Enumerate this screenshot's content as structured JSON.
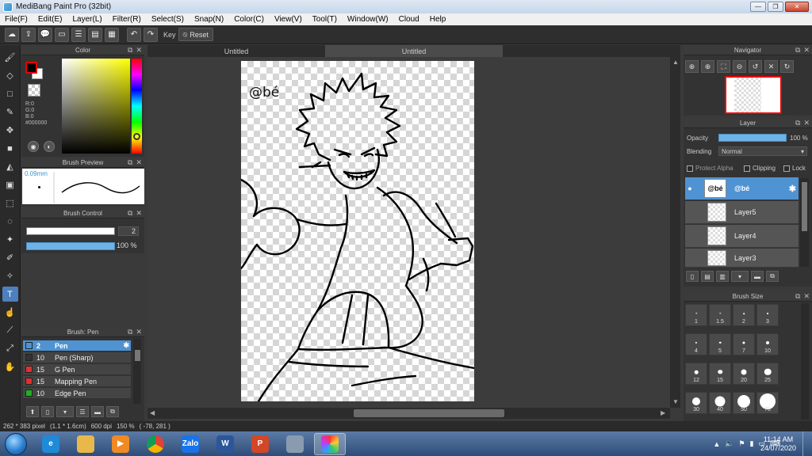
{
  "window": {
    "title": "MediBang Paint Pro (32bit)"
  },
  "menu": [
    "File(F)",
    "Edit(E)",
    "Layer(L)",
    "Filter(R)",
    "Select(S)",
    "Snap(N)",
    "Color(C)",
    "View(V)",
    "Tool(T)",
    "Window(W)",
    "Cloud",
    "Help"
  ],
  "toolbar": {
    "key_label": "Key",
    "reset_label": "Reset"
  },
  "color_panel": {
    "title": "Color",
    "r": "R:0",
    "g": "G:0",
    "b": "B:0",
    "hex": "#000000",
    "foreground": "#000000",
    "background": "#ffffff"
  },
  "brush_preview": {
    "title": "Brush Preview",
    "size": "0.09mm"
  },
  "brush_control": {
    "title": "Brush Control",
    "size_value": "2",
    "opacity_value": "100 %",
    "opacity_fraction": 1.0
  },
  "brush_list": {
    "title": "Brush: Pen",
    "items": [
      {
        "num": "2",
        "name": "Pen",
        "color": "#4f93d2",
        "selected": true
      },
      {
        "num": "10",
        "name": "Pen (Sharp)",
        "color": "#333333",
        "selected": false
      },
      {
        "num": "15",
        "name": "G Pen",
        "color": "#e03030",
        "selected": false
      },
      {
        "num": "15",
        "name": "Mapping Pen",
        "color": "#e03030",
        "selected": false
      },
      {
        "num": "10",
        "name": "Edge Pen",
        "color": "#20b020",
        "selected": false
      }
    ]
  },
  "tabs": [
    "Untitled",
    "Untitled"
  ],
  "canvas": {
    "watermark": "@bé"
  },
  "navigator": {
    "title": "Navigator"
  },
  "layer_panel": {
    "title": "Layer",
    "opacity_label": "Opacity",
    "opacity_value": "100 %",
    "blending_label": "Blending",
    "blending_value": "Normal",
    "protect_alpha": "Protect Alpha",
    "clipping": "Clipping",
    "lock": "Lock",
    "layers": [
      {
        "name": "@bé",
        "thumb_text": "@bé",
        "selected": true
      },
      {
        "name": "Layer5",
        "selected": false
      },
      {
        "name": "Layer4",
        "selected": false
      },
      {
        "name": "Layer3",
        "selected": false
      }
    ]
  },
  "brush_size_panel": {
    "title": "Brush Size",
    "sizes": [
      "1",
      "1.5",
      "2",
      "3",
      "4",
      "5",
      "7",
      "10",
      "12",
      "15",
      "20",
      "25",
      "30",
      "40",
      "50",
      "70"
    ]
  },
  "status": {
    "dimensions": "262 * 383 pixel",
    "physical": "(1.1 * 1.6cm)",
    "dpi": "600 dpi",
    "zoom": "150 %",
    "coords": "( -78, 281 )"
  },
  "taskbar": {
    "apps": [
      {
        "name": "internet-explorer",
        "label": "e",
        "color": "#1f8ad6"
      },
      {
        "name": "file-explorer",
        "label": "",
        "color": "#e8b84a"
      },
      {
        "name": "media-player",
        "label": "▶",
        "color": "#f08a24"
      },
      {
        "name": "chrome",
        "label": "",
        "color": "#dd4b39"
      },
      {
        "name": "zalo",
        "label": "Zalo",
        "color": "#1a73e8"
      },
      {
        "name": "word",
        "label": "W",
        "color": "#2b579a"
      },
      {
        "name": "powerpoint",
        "label": "P",
        "color": "#d24726"
      },
      {
        "name": "calculator",
        "label": "",
        "color": "#8a9bb0"
      },
      {
        "name": "medibang",
        "label": "",
        "color": "#ffffff"
      }
    ],
    "time": "11:14 AM",
    "date": "24/07/2020"
  }
}
